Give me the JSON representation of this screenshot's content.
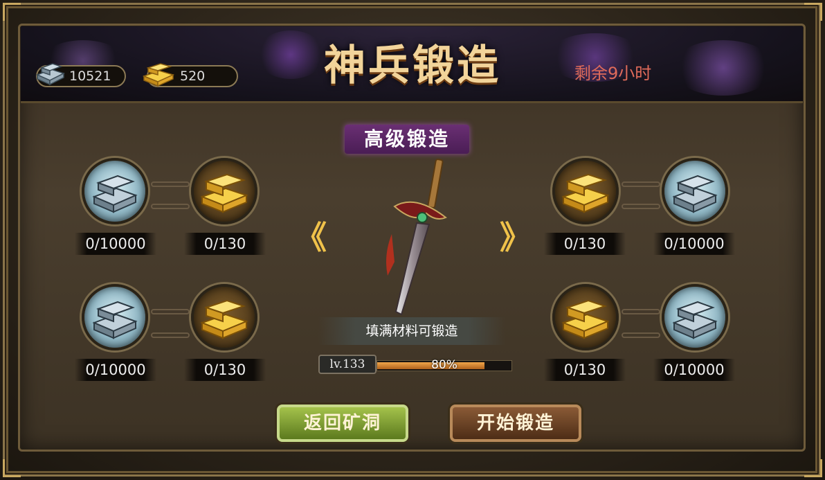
{
  "header": {
    "title": "神兵锻造",
    "timer": "剩余9小时"
  },
  "resources": {
    "iron": {
      "icon": "iron-ingot-icon",
      "value": "10521"
    },
    "gold": {
      "icon": "gold-ingot-icon",
      "value": "520"
    }
  },
  "mode": {
    "label": "高级锻造"
  },
  "nav": {
    "prev": "《",
    "next": "》"
  },
  "slots": {
    "left_top": {
      "iron": "0/10000",
      "gold": "0/130"
    },
    "left_bottom": {
      "iron": "0/10000",
      "gold": "0/130"
    },
    "right_top": {
      "gold": "0/130",
      "iron": "0/10000"
    },
    "right_bottom": {
      "gold": "0/130",
      "iron": "0/10000"
    }
  },
  "weapon": {
    "hint": "填满材料可锻造",
    "level": "lv.133",
    "progress_text": "80%",
    "progress": 0.8
  },
  "buttons": {
    "back": "返回矿洞",
    "forge": "开始锻造"
  },
  "colors": {
    "accent_gold": "#f2d49a",
    "timer_red": "#e06b5a",
    "mode_purple": "#6a2f73",
    "back_green": "#a4c24b",
    "forge_brown": "#8a5a36"
  }
}
